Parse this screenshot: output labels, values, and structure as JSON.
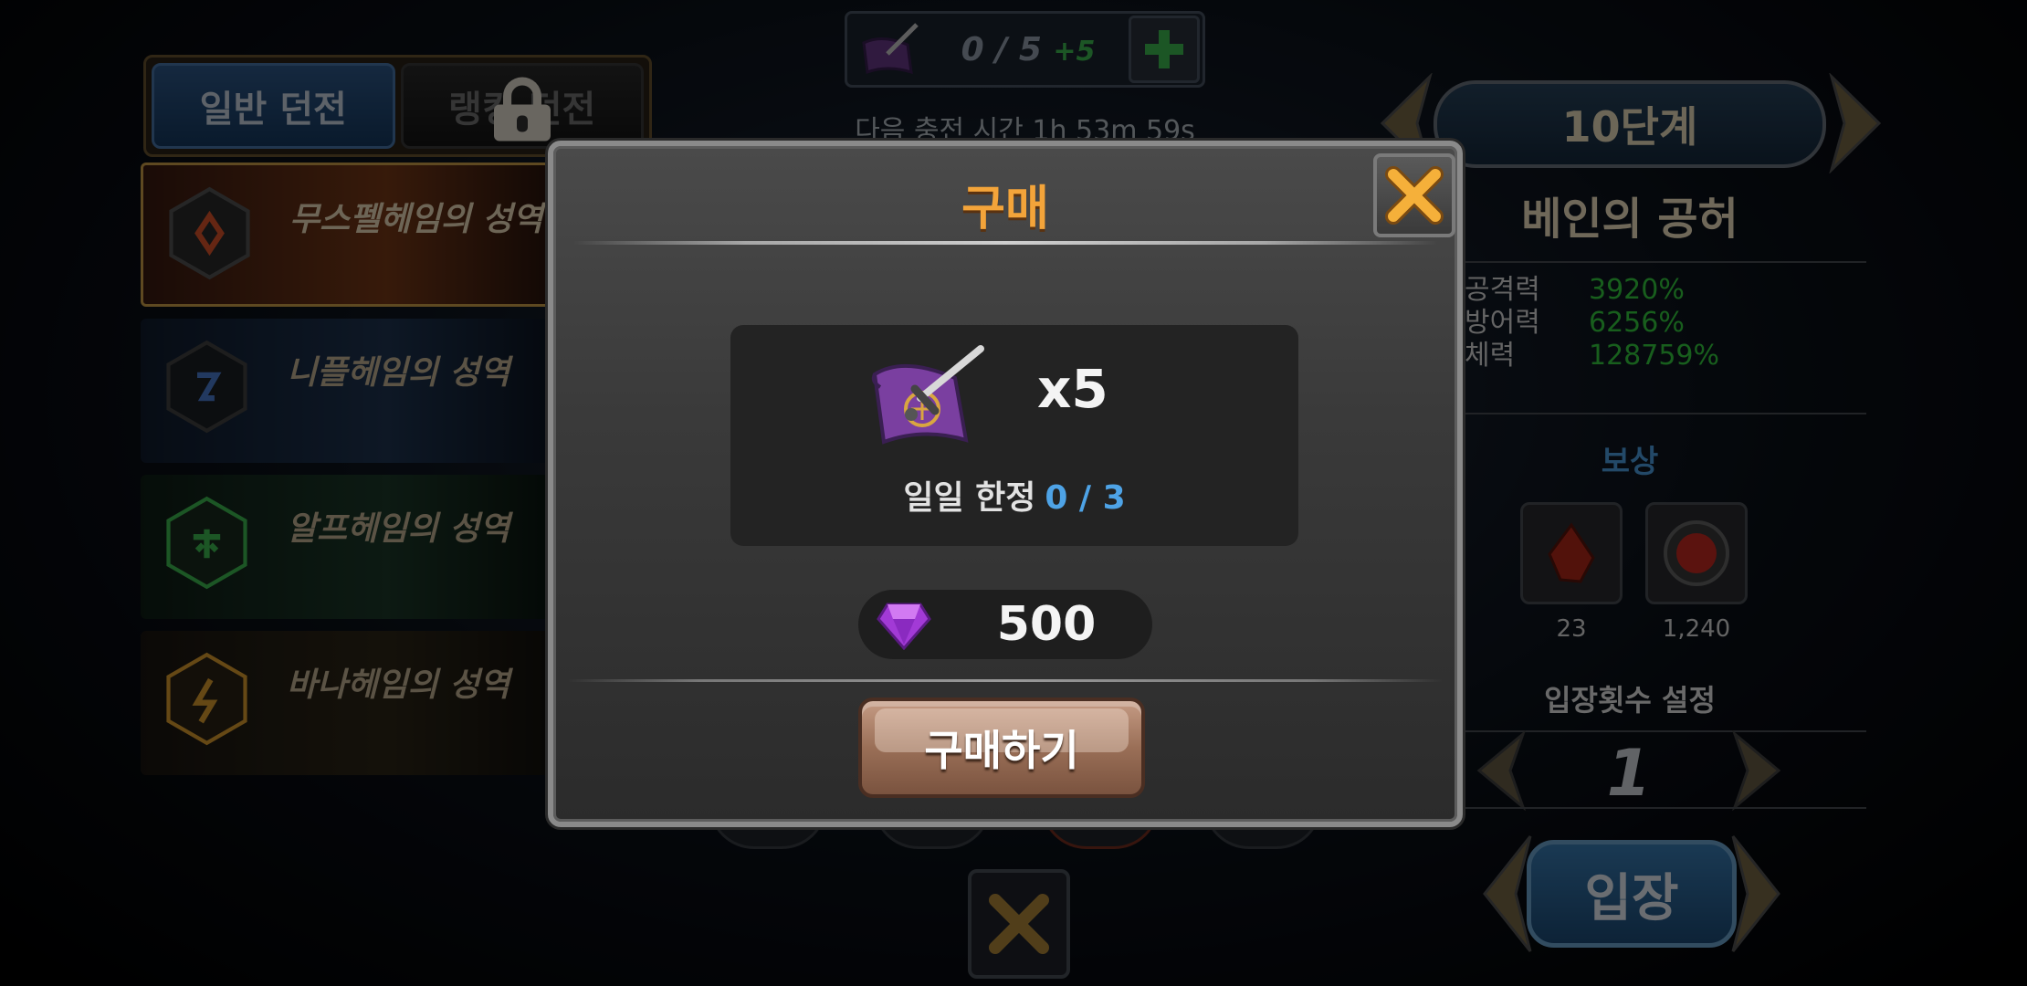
{
  "dungeon_tabs": {
    "normal_label": "일반 던전",
    "rank_label": "랭킹 던전"
  },
  "sanctums": [
    {
      "name": "무스펠헤임의 성역",
      "emblem": "fire-rune-icon",
      "color": "#e0562a"
    },
    {
      "name": "니플헤임의 성역",
      "emblem": "ice-rune-icon",
      "color": "#4d7fd6"
    },
    {
      "name": "알프헤임의 성역",
      "emblem": "nature-rune-icon",
      "color": "#3fbf52"
    },
    {
      "name": "바나헤임의 성역",
      "emblem": "lightning-rune-icon",
      "color": "#e0a030"
    }
  ],
  "ticket_counter": {
    "count": "0 / 5",
    "bonus": "+5"
  },
  "recharge_text": "다음 충전 시간 1h 53m 59s",
  "right_panel": {
    "stage": "10단계",
    "boss_name": "베인의 공허",
    "stats": [
      {
        "label": "공격력",
        "value": "3920%"
      },
      {
        "label": "방어력",
        "value": "6256%"
      },
      {
        "label": "체력",
        "value": "128759%"
      }
    ],
    "reward_title": "보상",
    "rewards": [
      {
        "icon": "red-shard-icon",
        "count": "23"
      },
      {
        "icon": "red-orb-icon",
        "count": "1,240"
      }
    ],
    "entry_label": "입장횟수 설정",
    "entry_count": "1",
    "enter_label": "입장"
  },
  "modal": {
    "title": "구매",
    "item_icon": "ticket-scroll-icon",
    "item_qty": "x5",
    "daily_limit_label": "일일 한정",
    "daily_limit_count": "0 / 3",
    "currency_icon": "purple-gem-icon",
    "price": "500",
    "buy_label": "구매하기"
  },
  "colors": {
    "modal_title": "#f3a43a",
    "highlight_blue": "#4ea3e6",
    "stat_green": "#35d040"
  }
}
